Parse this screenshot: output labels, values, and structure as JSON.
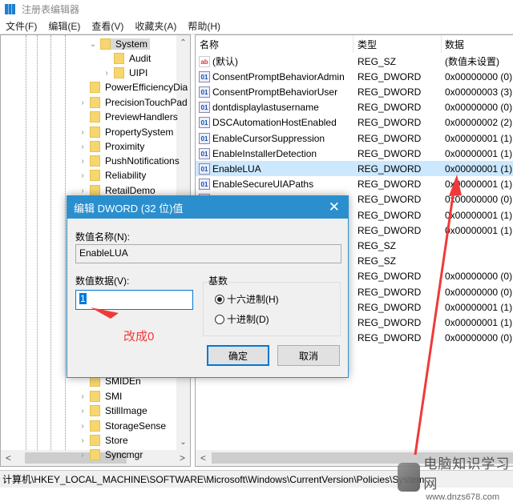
{
  "window": {
    "title": "注册表编辑器",
    "icon": "regedit-icon"
  },
  "menu": [
    "文件(F)",
    "编辑(E)",
    "查看(V)",
    "收藏夹(A)",
    "帮助(H)"
  ],
  "tree": {
    "items": [
      {
        "label": "System",
        "selected": true,
        "expanded": true
      },
      {
        "label": "Audit"
      },
      {
        "label": "UIPI"
      },
      {
        "label": "PowerEfficiencyDia"
      },
      {
        "label": "PrecisionTouchPad"
      },
      {
        "label": "PreviewHandlers"
      },
      {
        "label": "PropertySystem"
      },
      {
        "label": "Proximity"
      },
      {
        "label": "PushNotifications"
      },
      {
        "label": "Reliability"
      },
      {
        "label": "RetailDemo"
      },
      {
        "label": "SMIDEn"
      },
      {
        "label": "SMI"
      },
      {
        "label": "StillImage"
      },
      {
        "label": "StorageSense"
      },
      {
        "label": "Store"
      },
      {
        "label": "Syncmgr"
      }
    ]
  },
  "list": {
    "headers": [
      "名称",
      "类型",
      "数据"
    ],
    "rows": [
      {
        "name": "(默认)",
        "type": "REG_SZ",
        "data": "(数值未设置)",
        "icon": "ab"
      },
      {
        "name": "ConsentPromptBehaviorAdmin",
        "type": "REG_DWORD",
        "data": "0x00000000 (0)"
      },
      {
        "name": "ConsentPromptBehaviorUser",
        "type": "REG_DWORD",
        "data": "0x00000003 (3)"
      },
      {
        "name": "dontdisplaylastusername",
        "type": "REG_DWORD",
        "data": "0x00000000 (0)"
      },
      {
        "name": "DSCAutomationHostEnabled",
        "type": "REG_DWORD",
        "data": "0x00000002 (2)"
      },
      {
        "name": "EnableCursorSuppression",
        "type": "REG_DWORD",
        "data": "0x00000001 (1)"
      },
      {
        "name": "EnableInstallerDetection",
        "type": "REG_DWORD",
        "data": "0x00000001 (1)"
      },
      {
        "name": "EnableLUA",
        "type": "REG_DWORD",
        "data": "0x00000001 (1)",
        "selected": true
      },
      {
        "name": "EnableSecureUIAPaths",
        "type": "REG_DWORD",
        "data": "0x00000001 (1)"
      },
      {
        "name": "",
        "type": "REG_DWORD",
        "data": "0x00000000 (0)"
      },
      {
        "name": "",
        "type": "REG_DWORD",
        "data": "0x00000001 (1)"
      },
      {
        "name": "",
        "type": "REG_DWORD",
        "data": "0x00000001 (1)"
      },
      {
        "name": "",
        "type": "REG_SZ",
        "data": ""
      },
      {
        "name": "",
        "type": "REG_SZ",
        "data": ""
      },
      {
        "name": "",
        "type": "REG_DWORD",
        "data": "0x00000000 (0)"
      },
      {
        "name": "",
        "type": "REG_DWORD",
        "data": "0x00000000 (0)"
      },
      {
        "name": "",
        "type": "REG_DWORD",
        "data": "0x00000001 (1)"
      },
      {
        "name": "",
        "type": "REG_DWORD",
        "data": "0x00000001 (1)"
      },
      {
        "name": "",
        "type": "REG_DWORD",
        "data": "0x00000000 (0)"
      }
    ]
  },
  "statusbar": "计算机\\HKEY_LOCAL_MACHINE\\SOFTWARE\\Microsoft\\Windows\\CurrentVersion\\Policies\\System",
  "dialog": {
    "title": "编辑 DWORD (32 位)值",
    "name_label": "数值名称(N):",
    "name_value": "EnableLUA",
    "data_label": "数值数据(V):",
    "data_value": "1",
    "base_label": "基数",
    "hex_label": "十六进制(H)",
    "dec_label": "十进制(D)",
    "base_selected": "hex",
    "ok": "确定",
    "cancel": "取消"
  },
  "annotation": {
    "text": "改成0",
    "color": "#f03a3a"
  },
  "watermark": {
    "name": "电脑知识学习网",
    "url": "www.dnzs678.com"
  },
  "colors": {
    "accent": "#2b8fce",
    "selection": "#cce8ff",
    "arrow": "#f03a3a"
  }
}
